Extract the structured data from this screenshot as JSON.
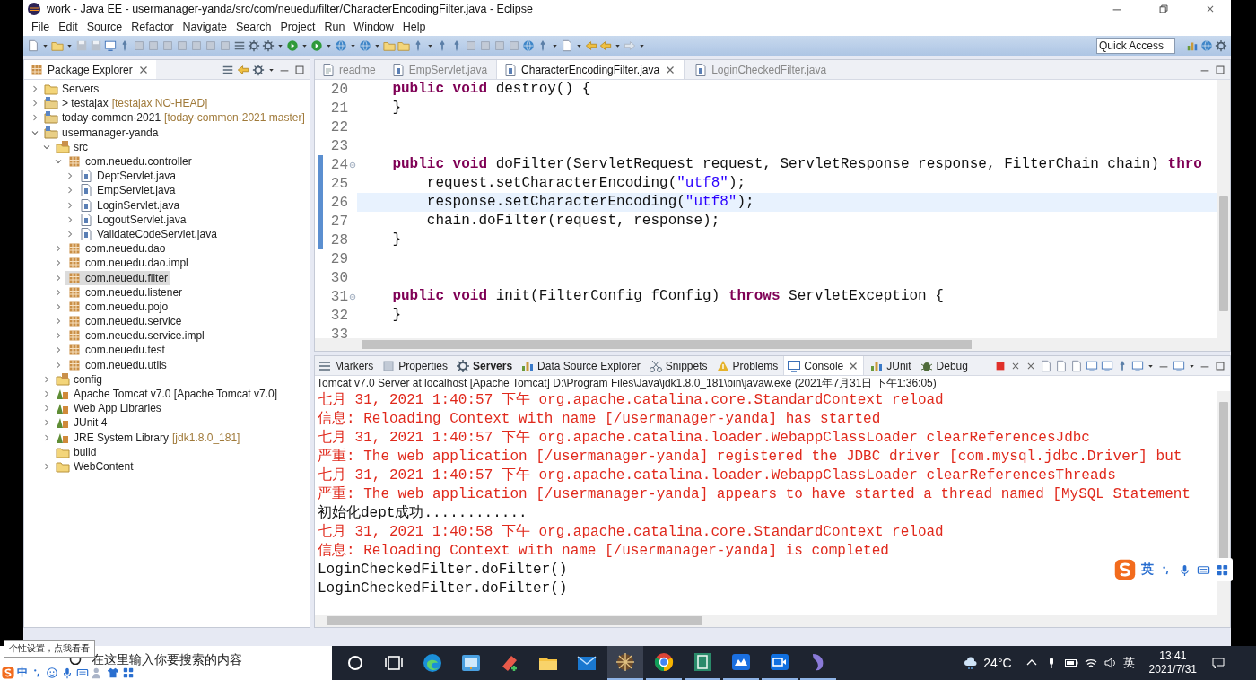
{
  "window": {
    "title": "work - Java EE - usermanager-yanda/src/com/neuedu/filter/CharacterEncodingFilter.java - Eclipse"
  },
  "menu": [
    "File",
    "Edit",
    "Source",
    "Refactor",
    "Navigate",
    "Search",
    "Project",
    "Run",
    "Window",
    "Help"
  ],
  "quick_access": {
    "placeholder": "Quick Access"
  },
  "package_explorer": {
    "title": "Package Explorer",
    "tree": [
      {
        "label": "Servers",
        "kind": "folder",
        "expanded": false,
        "selected": false
      },
      {
        "label": "> testajax",
        "note": "[testajax NO-HEAD]",
        "kind": "project",
        "expanded": false,
        "selected": false
      },
      {
        "label": "today-common-2021",
        "note": "[today-common-2021 master]",
        "kind": "project",
        "expanded": false,
        "selected": false
      },
      {
        "label": "usermanager-yanda",
        "kind": "project",
        "expanded": true,
        "selected": false,
        "children": [
          {
            "label": "src",
            "kind": "source",
            "expanded": true,
            "selected": false,
            "children": [
              {
                "label": "com.neuedu.controller",
                "kind": "package",
                "expanded": true,
                "selected": false,
                "children": [
                  {
                    "label": "DeptServlet.java",
                    "kind": "java",
                    "expanded": false,
                    "selected": false
                  },
                  {
                    "label": "EmpServlet.java",
                    "kind": "java",
                    "expanded": false,
                    "selected": false
                  },
                  {
                    "label": "LoginServlet.java",
                    "kind": "java",
                    "expanded": false,
                    "selected": false
                  },
                  {
                    "label": "LogoutServlet.java",
                    "kind": "java",
                    "expanded": false,
                    "selected": false
                  },
                  {
                    "label": "ValidateCodeServlet.java",
                    "kind": "java",
                    "expanded": false,
                    "selected": false
                  }
                ]
              },
              {
                "label": "com.neuedu.dao",
                "kind": "package",
                "expanded": false,
                "selected": false
              },
              {
                "label": "com.neuedu.dao.impl",
                "kind": "package",
                "expanded": false,
                "selected": false
              },
              {
                "label": "com.neuedu.filter",
                "kind": "package",
                "expanded": false,
                "selected": true
              },
              {
                "label": "com.neuedu.listener",
                "kind": "package",
                "expanded": false,
                "selected": false
              },
              {
                "label": "com.neuedu.pojo",
                "kind": "package",
                "expanded": false,
                "selected": false
              },
              {
                "label": "com.neuedu.service",
                "kind": "package",
                "expanded": false,
                "selected": false
              },
              {
                "label": "com.neuedu.service.impl",
                "kind": "package",
                "expanded": false,
                "selected": false
              },
              {
                "label": "com.neuedu.test",
                "kind": "package",
                "expanded": false,
                "selected": false
              },
              {
                "label": "com.neuedu.utils",
                "kind": "package",
                "expanded": false,
                "selected": false
              }
            ]
          },
          {
            "label": "config",
            "kind": "source",
            "expanded": false,
            "selected": false
          },
          {
            "label": "Apache Tomcat v7.0 [Apache Tomcat v7.0]",
            "kind": "library",
            "expanded": false,
            "selected": false
          },
          {
            "label": "Web App Libraries",
            "kind": "library",
            "expanded": false,
            "selected": false
          },
          {
            "label": "JUnit 4",
            "kind": "library",
            "expanded": false,
            "selected": false
          },
          {
            "label": "JRE System Library",
            "note": "[jdk1.8.0_181]",
            "kind": "library",
            "expanded": false,
            "selected": false
          },
          {
            "label": "build",
            "kind": "folder",
            "selected": false
          },
          {
            "label": "WebContent",
            "kind": "folder",
            "expanded": false,
            "selected": false
          }
        ]
      }
    ]
  },
  "editor": {
    "tabs": [
      {
        "label": "readme",
        "kind": "text",
        "selected": false
      },
      {
        "label": "EmpServlet.java",
        "kind": "java",
        "selected": false
      },
      {
        "label": "CharacterEncodingFilter.java",
        "kind": "java",
        "selected": true
      },
      {
        "label": "LoginCheckedFilter.java",
        "kind": "java",
        "selected": false
      }
    ],
    "lines": [
      {
        "number": "20",
        "current": false,
        "foldable": false,
        "range": false,
        "tokens": [
          {
            "kind": "keyword",
            "text": "    public void"
          },
          {
            "kind": "plain",
            "text": " destroy() {"
          }
        ]
      },
      {
        "number": "21",
        "current": false,
        "foldable": false,
        "range": false,
        "tokens": [
          {
            "kind": "plain",
            "text": "    }"
          }
        ]
      },
      {
        "number": "22",
        "current": false,
        "foldable": false,
        "range": false
      },
      {
        "number": "23",
        "current": false,
        "foldable": false,
        "range": false
      },
      {
        "number": "24",
        "current": false,
        "foldable": true,
        "range": true,
        "tokens": [
          {
            "kind": "keyword",
            "text": "    public void"
          },
          {
            "kind": "plain",
            "text": " doFilter(ServletRequest request, ServletResponse response, FilterChain chain) "
          },
          {
            "kind": "keyword",
            "text": "thro"
          }
        ]
      },
      {
        "number": "25",
        "current": false,
        "foldable": false,
        "range": true,
        "tokens": [
          {
            "kind": "plain",
            "text": "        request.setCharacterEncoding("
          },
          {
            "kind": "string",
            "text": "\"utf8\""
          },
          {
            "kind": "plain",
            "text": ");"
          }
        ]
      },
      {
        "number": "26",
        "current": true,
        "foldable": false,
        "range": true,
        "tokens": [
          {
            "kind": "plain",
            "text": "        response.setCharacterEncoding("
          },
          {
            "kind": "string",
            "text": "\"utf8\""
          },
          {
            "kind": "plain",
            "text": ");"
          }
        ]
      },
      {
        "number": "27",
        "current": false,
        "foldable": false,
        "range": true,
        "tokens": [
          {
            "kind": "plain",
            "text": "        chain.doFilter(request, response);"
          }
        ]
      },
      {
        "number": "28",
        "current": false,
        "foldable": false,
        "range": true,
        "tokens": [
          {
            "kind": "plain",
            "text": "    }"
          }
        ]
      },
      {
        "number": "29",
        "current": false,
        "foldable": false,
        "range": false
      },
      {
        "number": "30",
        "current": false,
        "foldable": false,
        "range": false
      },
      {
        "number": "31",
        "current": false,
        "foldable": true,
        "range": false,
        "tokens": [
          {
            "kind": "keyword",
            "text": "    public void"
          },
          {
            "kind": "plain",
            "text": " init(FilterConfig fConfig) "
          },
          {
            "kind": "keyword",
            "text": "throws"
          },
          {
            "kind": "plain",
            "text": " ServletException {"
          }
        ]
      },
      {
        "number": "32",
        "current": false,
        "foldable": false,
        "range": false,
        "tokens": [
          {
            "kind": "plain",
            "text": "    }"
          }
        ]
      },
      {
        "number": "33",
        "current": false,
        "foldable": false,
        "range": false
      }
    ]
  },
  "bottom_panel": {
    "tabs": [
      {
        "label": "Markers",
        "kind": "markers",
        "selected": false,
        "emphasized": false
      },
      {
        "label": "Properties",
        "kind": "properties",
        "selected": false,
        "emphasized": false
      },
      {
        "label": "Servers",
        "kind": "servers",
        "selected": false,
        "emphasized": true
      },
      {
        "label": "Data Source Explorer",
        "kind": "datasource",
        "selected": false,
        "emphasized": false
      },
      {
        "label": "Snippets",
        "kind": "snippets",
        "selected": false,
        "emphasized": false
      },
      {
        "label": "Problems",
        "kind": "problems",
        "selected": false,
        "emphasized": false
      },
      {
        "label": "Console",
        "kind": "console",
        "selected": true,
        "emphasized": false
      },
      {
        "label": "JUnit",
        "kind": "junit",
        "selected": false,
        "emphasized": false
      },
      {
        "label": "Debug",
        "kind": "debug",
        "selected": false,
        "emphasized": false
      }
    ],
    "console_description": "Tomcat v7.0 Server at localhost [Apache Tomcat] D:\\Program Files\\Java\\jdk1.8.0_181\\bin\\javaw.exe (2021年7月31日 下午1:36:05)",
    "console_lines": [
      {
        "kind": "err",
        "text": "七月 31, 2021 1:40:57 下午 org.apache.catalina.core.StandardContext reload"
      },
      {
        "kind": "err",
        "text": "信息: Reloading Context with name [/usermanager-yanda] has started"
      },
      {
        "kind": "err",
        "text": "七月 31, 2021 1:40:57 下午 org.apache.catalina.loader.WebappClassLoader clearReferencesJdbc"
      },
      {
        "kind": "err",
        "text": "严重: The web application [/usermanager-yanda] registered the JDBC driver [com.mysql.jdbc.Driver] but"
      },
      {
        "kind": "err",
        "text": "七月 31, 2021 1:40:57 下午 org.apache.catalina.loader.WebappClassLoader clearReferencesThreads"
      },
      {
        "kind": "err",
        "text": "严重: The web application [/usermanager-yanda] appears to have started a thread named [MySQL Statement"
      },
      {
        "kind": "out",
        "text": "初始化dept成功............"
      },
      {
        "kind": "err",
        "text": "七月 31, 2021 1:40:58 下午 org.apache.catalina.core.StandardContext reload"
      },
      {
        "kind": "err",
        "text": "信息: Reloading Context with name [/usermanager-yanda] is completed"
      },
      {
        "kind": "out",
        "text": "LoginCheckedFilter.doFilter()"
      },
      {
        "kind": "out",
        "text": "LoginCheckedFilter.doFilter()"
      }
    ]
  },
  "ime_toolbar": {
    "mode": "英"
  },
  "taskbar": {
    "tooltip": "个性设置，点我看看",
    "sogou_mode": "中",
    "search": {
      "placeholder": "在这里输入你要搜索的内容"
    },
    "apps": [
      {
        "kind": "cortana",
        "active": false,
        "running": false
      },
      {
        "kind": "taskview",
        "active": false,
        "running": false
      },
      {
        "kind": "browser",
        "active": false,
        "running": false
      },
      {
        "kind": "tool",
        "active": false,
        "running": false
      },
      {
        "kind": "eraser",
        "active": false,
        "running": false
      },
      {
        "kind": "folder",
        "active": false,
        "running": false
      },
      {
        "kind": "mail",
        "active": false,
        "running": false
      },
      {
        "kind": "ide",
        "active": true,
        "running": true
      },
      {
        "kind": "chrome",
        "active": false,
        "running": true
      },
      {
        "kind": "notebook",
        "active": false,
        "running": true
      },
      {
        "kind": "meeting",
        "active": false,
        "running": true
      },
      {
        "kind": "video",
        "active": false,
        "running": true
      },
      {
        "kind": "dolphin",
        "active": false,
        "running": true
      }
    ],
    "weather": "24°C",
    "language": "英",
    "time": "13:41",
    "date": "2021/7/31"
  }
}
